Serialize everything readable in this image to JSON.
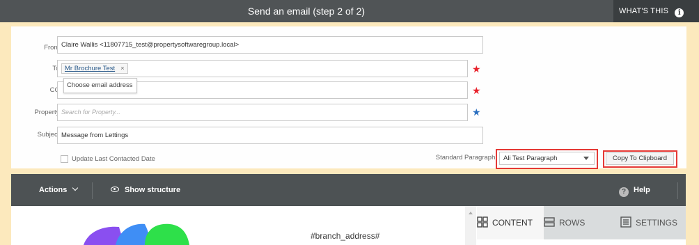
{
  "window": {
    "title": "Send an email (step 2 of 2)",
    "whats_this": "WHAT'S THIS"
  },
  "form": {
    "from_label": "From:",
    "from_value": "Claire Wallis <11807715_test@propertysoftwaregroup.local>",
    "to_label": "To:",
    "to_tag": "Mr Brochure Test",
    "to_tag_remove": "×",
    "to_dropdown_hint": "Choose email address",
    "cc_label": "CC:",
    "property_label": "Property:",
    "property_placeholder": "Search for Property...",
    "subject_label": "Subject:",
    "subject_value": "Message from Lettings",
    "update_contacted_label": "Update Last Contacted Date",
    "standard_paragraph_label": "Standard Paragraph:",
    "standard_paragraph_value": "Ali Test Paragraph",
    "copy_to_clipboard": "Copy To Clipboard",
    "required_star": "★",
    "property_star": "★"
  },
  "toolbar": {
    "actions_label": "Actions",
    "show_structure_label": "Show structure",
    "help_label": "Help",
    "help_icon_glyph": "?"
  },
  "editor": {
    "branch_address": "#branch_address#",
    "tabs": [
      {
        "label": "CONTENT",
        "icon": "grid-icon"
      },
      {
        "label": "ROWS",
        "icon": "rows-icon"
      },
      {
        "label": "SETTINGS",
        "icon": "settings-icon"
      }
    ]
  },
  "colors": {
    "titlebar": "#505456",
    "page_background": "#fce9bd",
    "highlight": "#e53935",
    "required_star": "#e8202a",
    "property_star": "#2a6fc0"
  }
}
